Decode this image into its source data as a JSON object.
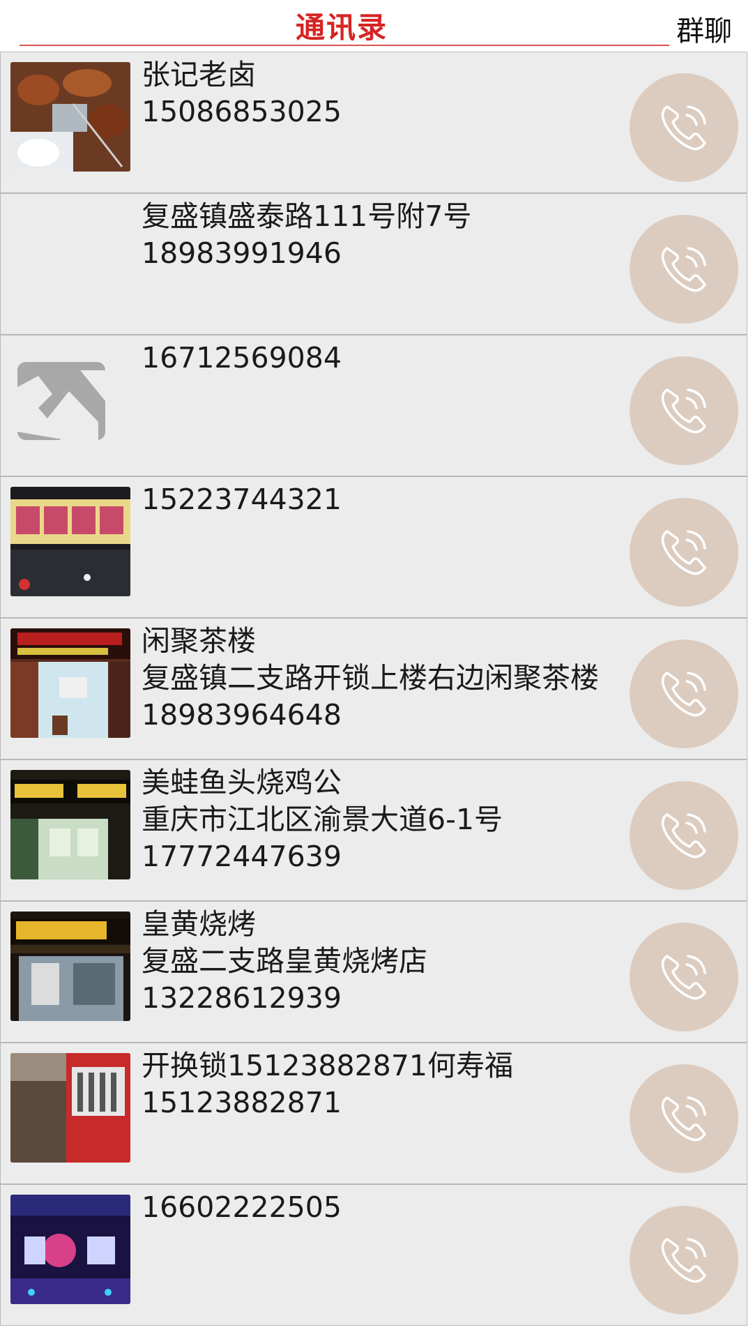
{
  "header": {
    "title": "通讯录",
    "group_chat": "群聊"
  },
  "contacts": [
    {
      "lines": [
        "张记老卤",
        "15086853025"
      ],
      "thumb": "photo-braised-meat"
    },
    {
      "lines": [
        "复盛镇盛泰路111号附7号",
        "18983991946"
      ],
      "thumb": "none"
    },
    {
      "lines": [
        "16712569084"
      ],
      "thumb": "image-placeholder-icon"
    },
    {
      "lines": [
        "15223744321"
      ],
      "thumb": "photo-shop-sign"
    },
    {
      "lines": [
        "闲聚茶楼",
        "复盛镇二支路开锁上楼右边闲聚茶楼",
        "18983964648"
      ],
      "thumb": "photo-teahouse"
    },
    {
      "lines": [
        "美蛙鱼头烧鸡公",
        "重庆市江北区渝景大道6-1号",
        "17772447639"
      ],
      "thumb": "photo-restaurant"
    },
    {
      "lines": [
        "皇黄烧烤",
        "复盛二支路皇黄烧烤店",
        "13228612939"
      ],
      "thumb": "photo-bbq"
    },
    {
      "lines": [
        "开换锁15123882871何寿福",
        "15123882871"
      ],
      "thumb": "photo-locksmith"
    },
    {
      "lines": [
        "16602222505"
      ],
      "thumb": "photo-chongqing"
    }
  ],
  "colors": {
    "title_red": "#d62424",
    "row_bg": "#ececec",
    "call_button": "#dcccc0"
  }
}
